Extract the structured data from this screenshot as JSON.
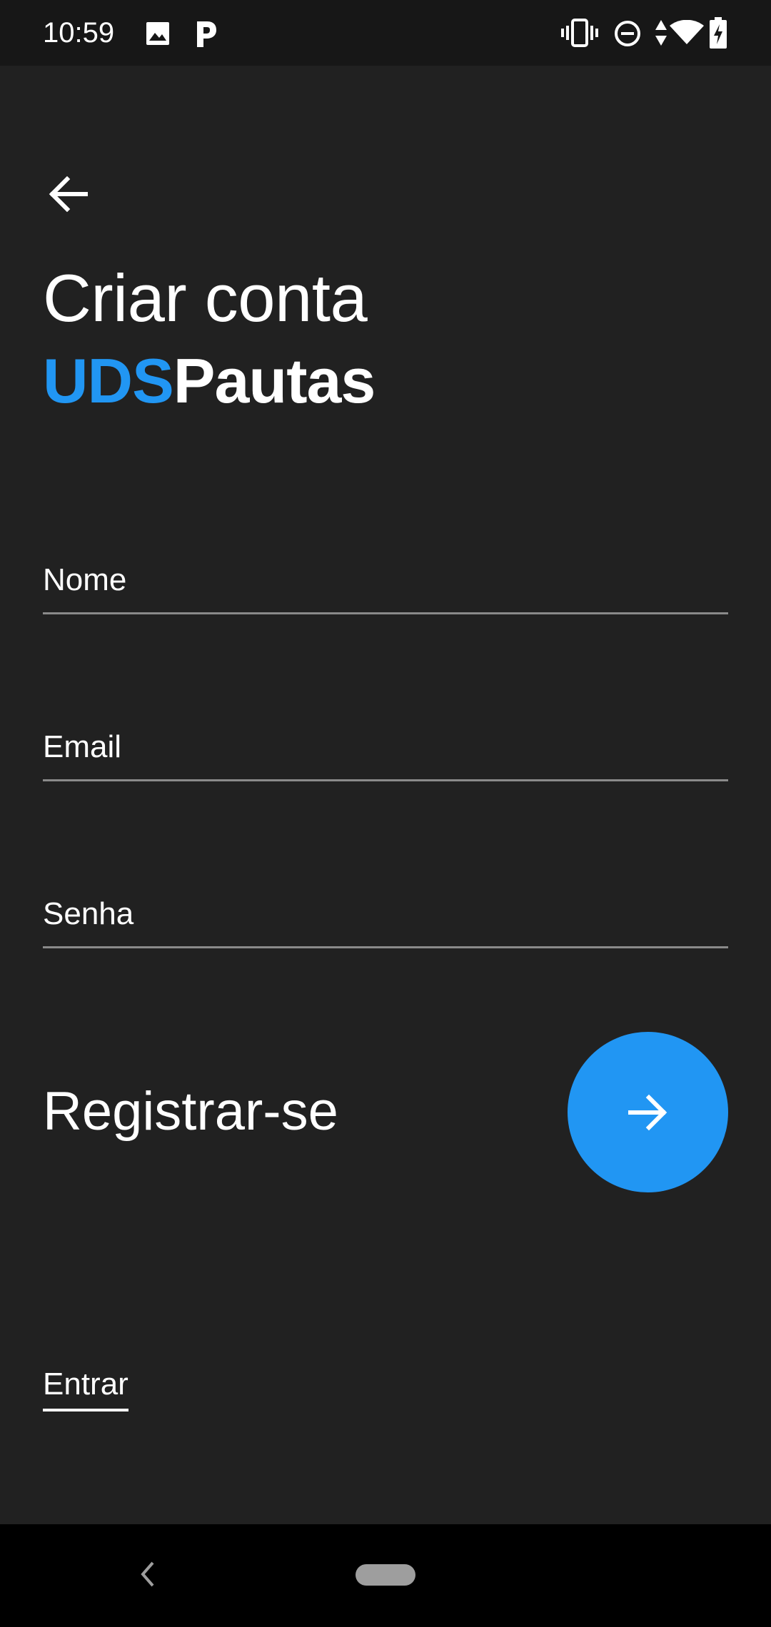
{
  "status_bar": {
    "time": "10:59",
    "icons": [
      "image-icon",
      "p-app-icon",
      "vibrate-icon",
      "dnd-icon",
      "data-arrows-icon",
      "wifi-icon",
      "battery-charging-icon"
    ]
  },
  "header": {
    "back_icon": "arrow-left-icon",
    "title": "Criar conta",
    "brand_accent": "UDS",
    "brand_rest": "Pautas"
  },
  "form": {
    "name_placeholder": "Nome",
    "email_placeholder": "Email",
    "password_placeholder": "Senha",
    "name_value": "",
    "email_value": "",
    "password_value": ""
  },
  "register": {
    "label": "Registrar-se",
    "button_icon": "arrow-right-icon"
  },
  "login_link": "Entrar",
  "colors": {
    "background": "#212121",
    "accent": "#2196F3",
    "status_bar": "#171717",
    "nav_bar": "#000000"
  }
}
